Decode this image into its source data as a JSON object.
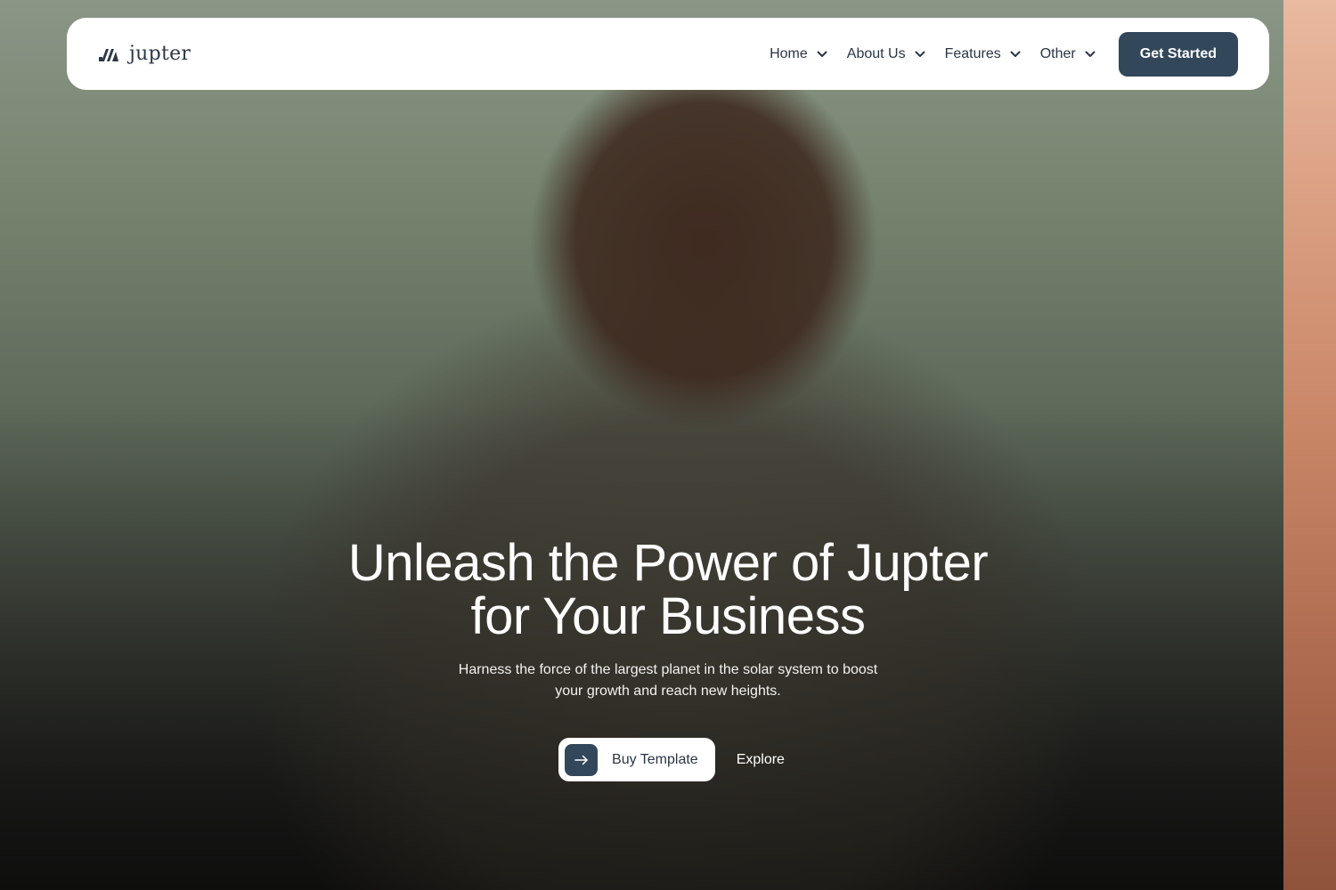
{
  "brand": {
    "name": "jupter",
    "logo_icon": "brand-logo-icon"
  },
  "nav": {
    "items": [
      {
        "label": "Home",
        "icon": "chevron-down-icon"
      },
      {
        "label": "About Us",
        "icon": "chevron-down-icon"
      },
      {
        "label": "Features",
        "icon": "chevron-down-icon"
      },
      {
        "label": "Other",
        "icon": "chevron-down-icon"
      }
    ],
    "cta_label": "Get Started"
  },
  "hero": {
    "title_line1": "Unleash the Power of Jupter",
    "title_line2": "for Your Business",
    "subtitle": "Harness the force of the largest planet in the solar system to boost your growth and reach new heights.",
    "buy_label": "Buy Template",
    "buy_icon": "arrow-right-icon",
    "explore_label": "Explore"
  },
  "colors": {
    "accent": "#33475b",
    "nav_text": "#2b3644",
    "nav_bg": "#ffffff"
  }
}
